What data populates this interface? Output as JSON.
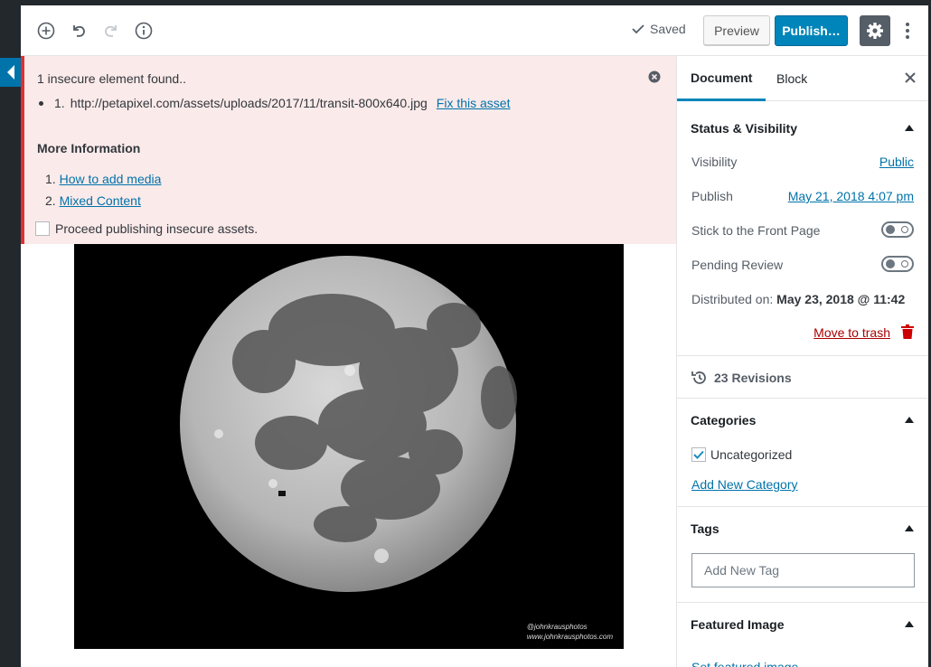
{
  "colors": {
    "accent": "#0085ba",
    "link": "#0073aa",
    "error_border": "#dc3232",
    "notice_bg": "#fbeaea",
    "trash": "#a00000"
  },
  "toolbar": {
    "icons": [
      "add-block-icon",
      "undo-icon",
      "redo-icon",
      "info-icon"
    ],
    "saved_label": "Saved",
    "preview_label": "Preview",
    "publish_label": "Publish…",
    "settings_icon": "gear-icon",
    "more_icon": "vertical-ellipsis-icon"
  },
  "notice": {
    "title": "1 insecure element found..",
    "items": [
      {
        "number": "1.",
        "url": "http://petapixel.com/assets/uploads/2017/11/transit-800x640.jpg",
        "fix_label": "Fix this asset"
      }
    ],
    "more_info_heading": "More Information",
    "links": [
      {
        "number": "1.",
        "label": "How to add media"
      },
      {
        "number": "2.",
        "label": "Mixed Content"
      }
    ],
    "proceed_label": "Proceed publishing insecure assets."
  },
  "image": {
    "alt": "Full moon photo",
    "watermark_handle": "@johnkrausphotos",
    "watermark_site": "www.johnkrausphotos.com"
  },
  "sidebar": {
    "tabs": [
      {
        "label": "Document",
        "active": true
      },
      {
        "label": "Block",
        "active": false
      }
    ],
    "status": {
      "title": "Status & Visibility",
      "visibility_label": "Visibility",
      "visibility_value": "Public",
      "publish_label": "Publish",
      "publish_value": "May 21, 2018 4:07 pm",
      "sticky_label": "Stick to the Front Page",
      "pending_label": "Pending Review",
      "distributed_prefix": "Distributed on:",
      "distributed_value": "May 23, 2018 @ 11:42",
      "trash_label": "Move to trash"
    },
    "revisions_label": "23 Revisions",
    "categories": {
      "title": "Categories",
      "items": [
        {
          "label": "Uncategorized",
          "checked": true
        }
      ],
      "add_label": "Add New Category"
    },
    "tags": {
      "title": "Tags",
      "placeholder": "Add New Tag"
    },
    "featured": {
      "title": "Featured Image",
      "set_label": "Set featured image"
    }
  }
}
